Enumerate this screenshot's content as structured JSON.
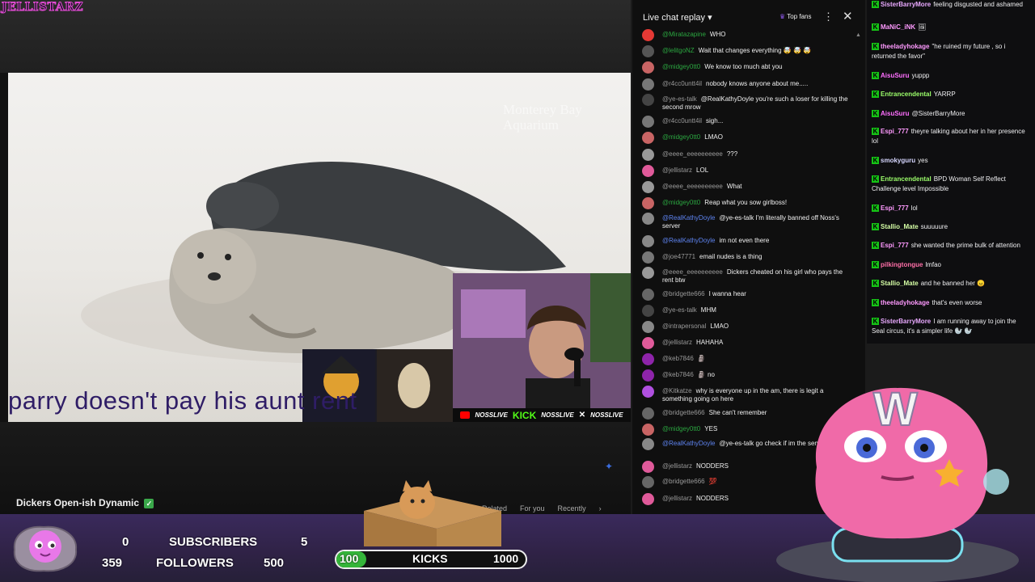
{
  "brand": {
    "logo_text": "JELLISTARZ"
  },
  "video": {
    "caption": "parry doesn't pay his aunt rent",
    "watermark": "Monterey Bay Aquarium",
    "title": "Dickers Open-ish Dynamic",
    "chips": [
      "Related",
      "For you",
      "Recently"
    ],
    "cam_logos": {
      "a": "NOSSLIVE",
      "kick": "KICK",
      "b": "NOSSLIVE",
      "c": "NOSSLIVE"
    }
  },
  "yt_chat": {
    "header": {
      "title": "Live chat replay",
      "top_fans": "Top fans",
      "more": "⋮",
      "close": "✕"
    },
    "messages": [
      {
        "user": "@Miratazapine",
        "text": "WHO",
        "color": "#e53935",
        "role": "mem"
      },
      {
        "user": "@lelitgoNZ",
        "text": "Wait that changes everything 🤯 🤯 🤯",
        "color": "#555",
        "role": "mem"
      },
      {
        "user": "@midgey0tt0",
        "text": "We know too much abt you",
        "color": "#c86464",
        "role": "mem"
      },
      {
        "user": "@r4cc0untt4il",
        "text": "nobody knows anyone about me.....",
        "color": "#777",
        "role": ""
      },
      {
        "user": "@ye-es-talk",
        "text": "@RealKathyDoyle you're such a loser for killing the second mrow",
        "color": "#444",
        "role": ""
      },
      {
        "user": "@r4cc0untt4il",
        "text": "sigh...",
        "color": "#777",
        "role": ""
      },
      {
        "user": "@midgey0tt0",
        "text": "LMAO",
        "color": "#c86464",
        "role": "mem"
      },
      {
        "user": "@eeee_eeeeeeeeee",
        "text": "???",
        "color": "#999",
        "role": ""
      },
      {
        "user": "@jellistarz",
        "text": "LOL",
        "color": "#e05a9a",
        "role": ""
      },
      {
        "user": "@eeee_eeeeeeeeee",
        "text": "What",
        "color": "#999",
        "role": ""
      },
      {
        "user": "@midgey0tt0",
        "text": "Reap what you sow girlboss!",
        "color": "#c86464",
        "role": "mem"
      },
      {
        "user": "@RealKathyDoyle",
        "text": "@ye-es-talk I'm literally banned off Noss's server",
        "color": "#888",
        "role": "mod"
      },
      {
        "user": "@RealKathyDoyle",
        "text": "im not even there",
        "color": "#888",
        "role": "mod"
      },
      {
        "user": "@joe47771",
        "text": "email nudes is a thing",
        "color": "#777",
        "role": ""
      },
      {
        "user": "@eeee_eeeeeeeeee",
        "text": "Dickers cheated on his girl who pays the rent btw",
        "color": "#999",
        "role": ""
      },
      {
        "user": "@bridgette666",
        "text": "I wanna hear",
        "color": "#666",
        "role": ""
      },
      {
        "user": "@ye-es-talk",
        "text": "MHM",
        "color": "#444",
        "role": ""
      },
      {
        "user": "@intrapersonal",
        "text": "LMAO",
        "color": "#888",
        "role": ""
      },
      {
        "user": "@jellistarz",
        "text": "HAHAHA",
        "color": "#e05a9a",
        "role": ""
      },
      {
        "user": "@keb7846",
        "text": "🗿",
        "color": "#8e24aa",
        "role": ""
      },
      {
        "user": "@keb7846",
        "text": "🗿 no",
        "color": "#8e24aa",
        "role": ""
      },
      {
        "user": "@Kitkatze",
        "text": "why is everyone up in the am, there is legit a something going on here",
        "color": "#b050e0",
        "role": ""
      },
      {
        "user": "@bridgette666",
        "text": "She can't remember",
        "color": "#666",
        "role": ""
      },
      {
        "user": "@midgey0tt0",
        "text": "YES",
        "color": "#c86464",
        "role": "mem"
      },
      {
        "user": "@RealKathyDoyle",
        "text": "@ye-es-talk go check if im the server, im not",
        "color": "#888",
        "role": "mod"
      },
      {
        "user": "@jellistarz",
        "text": "NODDERS",
        "color": "#e05a9a",
        "role": ""
      },
      {
        "user": "@bridgette666",
        "text": "💯",
        "color": "#666",
        "role": ""
      },
      {
        "user": "@jellistarz",
        "text": "NODDERS",
        "color": "#e05a9a",
        "role": ""
      }
    ]
  },
  "tw_chat": {
    "messages": [
      {
        "user": "SisterBarryMore",
        "text": "feeling disgusted and ashamed",
        "color": "#e9a9ff"
      },
      {
        "user": "MaNiC_iNK",
        "text": "🖼",
        "color": "#ff9aff"
      },
      {
        "user": "theeladyhokage",
        "text": "\"he ruined my future , so i returned the favor\"",
        "color": "#ff9aff"
      },
      {
        "user": "AisuSuru",
        "text": "yuppp",
        "color": "#ff6fff"
      },
      {
        "user": "Entrancendental",
        "text": "YARRP",
        "color": "#9cff6b"
      },
      {
        "user": "AisuSuru",
        "text": "@SisterBarryMore",
        "color": "#ff6fff"
      },
      {
        "user": "Espi_777",
        "text": "theyre talking about her in her presence lol",
        "color": "#ff9aff"
      },
      {
        "user": "smokyguru",
        "text": "yes",
        "color": "#d6d6ff"
      },
      {
        "user": "Entrancendental",
        "text": "BPD Woman Self Reflect Challenge level Impossible",
        "color": "#9cff6b"
      },
      {
        "user": "Espi_777",
        "text": "lol",
        "color": "#ff9aff"
      },
      {
        "user": "Stallio_Mate",
        "text": "suuuuure",
        "color": "#d6ffa6"
      },
      {
        "user": "Espi_777",
        "text": "she wanted the prime bulk of attention",
        "color": "#ff9aff"
      },
      {
        "user": "pilkingtongue",
        "text": "lmfao",
        "color": "#ff6fa8"
      },
      {
        "user": "Stallio_Mate",
        "text": "and he banned her 😠",
        "color": "#d6ffa6"
      },
      {
        "user": "theeladyhokage",
        "text": "that's even worse",
        "color": "#ff9aff"
      },
      {
        "user": "SisterBarryMore",
        "text": "I am running away to join the Seal circus, it's a simpler life 🦭 🦭",
        "color": "#e9a9ff"
      }
    ]
  },
  "stats": {
    "subs_current": "0",
    "subs_label": "SUBSCRIBERS",
    "subs_goal": "5",
    "followers_current": "359",
    "followers_label": "FOLLOWERS",
    "followers_goal": "500",
    "kicks_current": "100",
    "kicks_label": "KICKS",
    "kicks_goal": "1000",
    "kicks_progress": 0.1
  },
  "colors": {
    "accent_pink": "#e24bd3",
    "mod_blue": "#5e84f1",
    "twitch_badge": "#16c416",
    "kick_green": "#35b53a"
  }
}
